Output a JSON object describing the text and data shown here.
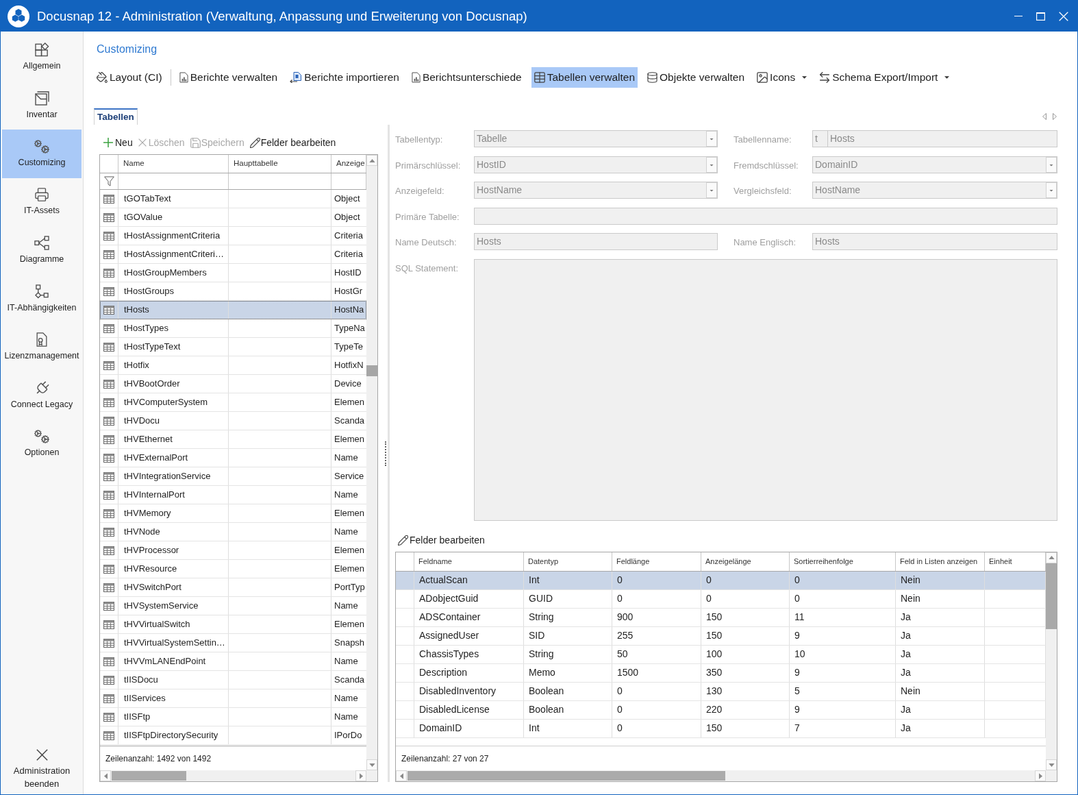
{
  "window": {
    "title": "Docusnap 12 - Administration (Verwaltung, Anpassung und Erweiterung von Docusnap)"
  },
  "sidebar": {
    "items": [
      {
        "label": "Allgemein",
        "selected": false
      },
      {
        "label": "Inventar",
        "selected": false
      },
      {
        "label": "Customizing",
        "selected": true
      },
      {
        "label": "IT-Assets",
        "selected": false
      },
      {
        "label": "Diagramme",
        "selected": false
      },
      {
        "label": "IT-Abhängigkeiten",
        "selected": false
      },
      {
        "label": "Lizenzmanagement",
        "selected": false
      },
      {
        "label": "Connect Legacy",
        "selected": false
      },
      {
        "label": "Optionen",
        "selected": false
      }
    ],
    "exit": {
      "label": "Administration beenden"
    }
  },
  "section": {
    "title": "Customizing"
  },
  "toolbar": {
    "groups": [
      {
        "items": [
          {
            "label": "Layout (CI)",
            "selected": false,
            "menu": false
          }
        ]
      },
      {
        "items": [
          {
            "label": "Berichte verwalten",
            "selected": false,
            "menu": false
          },
          {
            "label": "Berichte importieren",
            "selected": false,
            "menu": false
          },
          {
            "label": "Berichtsunterschiede",
            "selected": false,
            "menu": false
          },
          {
            "label": "Tabellen verwalten",
            "selected": true,
            "menu": false
          },
          {
            "label": "Objekte verwalten",
            "selected": false,
            "menu": false
          },
          {
            "label": "Icons",
            "selected": false,
            "menu": true
          },
          {
            "label": "Schema Export/Import",
            "selected": false,
            "menu": true
          }
        ]
      }
    ]
  },
  "tabs": [
    {
      "label": "Tabellen",
      "selected": true
    }
  ],
  "tables_panel": {
    "actions": [
      {
        "label": "Neu",
        "disabled": false
      },
      {
        "label": "Löschen",
        "disabled": true
      },
      {
        "label": "Speichern",
        "disabled": true
      },
      {
        "label": "Felder bearbeiten",
        "disabled": false
      }
    ],
    "columns": [
      "Name",
      "Haupttabelle",
      "Anzeige"
    ],
    "rows": [
      {
        "name": "tGOTabText",
        "display": "Object",
        "selected": false
      },
      {
        "name": "tGOValue",
        "display": "Object",
        "selected": false
      },
      {
        "name": "tHostAssignmentCriteria",
        "display": "Criteria",
        "selected": false
      },
      {
        "name": "tHostAssignmentCriteri…",
        "display": "Criteria",
        "selected": false
      },
      {
        "name": "tHostGroupMembers",
        "display": "HostID",
        "selected": false
      },
      {
        "name": "tHostGroups",
        "display": "HostGr",
        "selected": false
      },
      {
        "name": "tHosts",
        "display": "HostNa",
        "selected": true
      },
      {
        "name": "tHostTypes",
        "display": "TypeNa",
        "selected": false
      },
      {
        "name": "tHostTypeText",
        "display": "TypeTe",
        "selected": false
      },
      {
        "name": "tHotfix",
        "display": "HotfixN",
        "selected": false
      },
      {
        "name": "tHVBootOrder",
        "display": "Device",
        "selected": false
      },
      {
        "name": "tHVComputerSystem",
        "display": "Elemen",
        "selected": false
      },
      {
        "name": "tHVDocu",
        "display": "Scanda",
        "selected": false
      },
      {
        "name": "tHVEthernet",
        "display": "Elemen",
        "selected": false
      },
      {
        "name": "tHVExternalPort",
        "display": "Name",
        "selected": false
      },
      {
        "name": "tHVIntegrationService",
        "display": "Service",
        "selected": false
      },
      {
        "name": "tHVInternalPort",
        "display": "Name",
        "selected": false
      },
      {
        "name": "tHVMemory",
        "display": "Elemen",
        "selected": false
      },
      {
        "name": "tHVNode",
        "display": "Name",
        "selected": false
      },
      {
        "name": "tHVProcessor",
        "display": "Elemen",
        "selected": false
      },
      {
        "name": "tHVResource",
        "display": "Elemen",
        "selected": false
      },
      {
        "name": "tHVSwitchPort",
        "display": "PortTyp",
        "selected": false
      },
      {
        "name": "tHVSystemService",
        "display": "Name",
        "selected": false
      },
      {
        "name": "tHVVirtualSwitch",
        "display": "Elemen",
        "selected": false
      },
      {
        "name": "tHVVirtualSystemSettin…",
        "display": "Snapsh",
        "selected": false
      },
      {
        "name": "tHVVmLANEndPoint",
        "display": "Name",
        "selected": false
      },
      {
        "name": "tIISDocu",
        "display": "Scanda",
        "selected": false
      },
      {
        "name": "tIIServices",
        "display": "Name",
        "selected": false
      },
      {
        "name": "tIISFtp",
        "display": "Name",
        "selected": false
      },
      {
        "name": "tIISFtpDirectorySecurity",
        "display": "IPorDo",
        "selected": false
      }
    ],
    "row_count": "Zeilenanzahl: 1492 von 1492"
  },
  "form": {
    "rows": [
      {
        "fields": [
          {
            "label": "Tabellentyp:",
            "kind": "dropdown",
            "value": "Tabelle",
            "disabled": true
          },
          {
            "label": "Tabellenname:",
            "kind": "prefixed",
            "prefix": "t",
            "value": "Hosts",
            "disabled": true
          }
        ]
      },
      {
        "fields": [
          {
            "label": "Primärschlüssel:",
            "kind": "dropdown",
            "value": "HostID",
            "disabled": true
          },
          {
            "label": "Fremdschlüssel:",
            "kind": "dropdown",
            "value": "DomainID",
            "disabled": true
          }
        ]
      },
      {
        "fields": [
          {
            "label": "Anzeigefeld:",
            "kind": "dropdown",
            "value": "HostName",
            "disabled": true
          },
          {
            "label": "Vergleichsfeld:",
            "kind": "dropdown",
            "value": "HostName",
            "disabled": true
          }
        ]
      },
      {
        "fields": [
          {
            "label": "Primäre Tabelle:",
            "kind": "text",
            "disabled": true
          }
        ]
      },
      {
        "fields": [
          {
            "label": "Name Deutsch:",
            "kind": "text",
            "value": "Hosts",
            "disabled": true
          },
          {
            "label": "Name Englisch:",
            "kind": "text",
            "value": "Hosts",
            "disabled": true
          }
        ]
      },
      {
        "fields": [
          {
            "label": "SQL Statement:",
            "kind": "memo",
            "disabled": true
          }
        ]
      }
    ]
  },
  "fields_grid": {
    "action": {
      "label": "Felder bearbeiten"
    },
    "columns": [
      "Feldname",
      "Datentyp",
      "Feldlänge",
      "Anzeigelänge",
      "Sortierreihenfolge",
      "Feld in Listen anzeigen",
      "Einheit"
    ],
    "rows": [
      {
        "cells": [
          "ActualScan",
          "Int",
          "0",
          "0",
          "0",
          "Nein"
        ],
        "selected": true
      },
      {
        "cells": [
          "ADobjectGuid",
          "GUID",
          "0",
          "0",
          "0",
          "Nein"
        ],
        "selected": false
      },
      {
        "cells": [
          "ADSContainer",
          "String",
          "900",
          "150",
          "11",
          "Ja"
        ],
        "selected": false
      },
      {
        "cells": [
          "AssignedUser",
          "SID",
          "255",
          "150",
          "9",
          "Ja"
        ],
        "selected": false
      },
      {
        "cells": [
          "ChassisTypes",
          "String",
          "50",
          "100",
          "10",
          "Ja"
        ],
        "selected": false
      },
      {
        "cells": [
          "Description",
          "Memo",
          "1500",
          "350",
          "9",
          "Ja"
        ],
        "selected": false
      },
      {
        "cells": [
          "DisabledInventory",
          "Boolean",
          "0",
          "130",
          "5",
          "Nein"
        ],
        "selected": false
      },
      {
        "cells": [
          "DisabledLicense",
          "Boolean",
          "0",
          "220",
          "9",
          "Ja"
        ],
        "selected": false
      },
      {
        "cells": [
          "DomainID",
          "Int",
          "0",
          "150",
          "7",
          "Ja"
        ],
        "selected": false
      }
    ],
    "row_count": "Zeilenanzahl: 27 von 27"
  }
}
